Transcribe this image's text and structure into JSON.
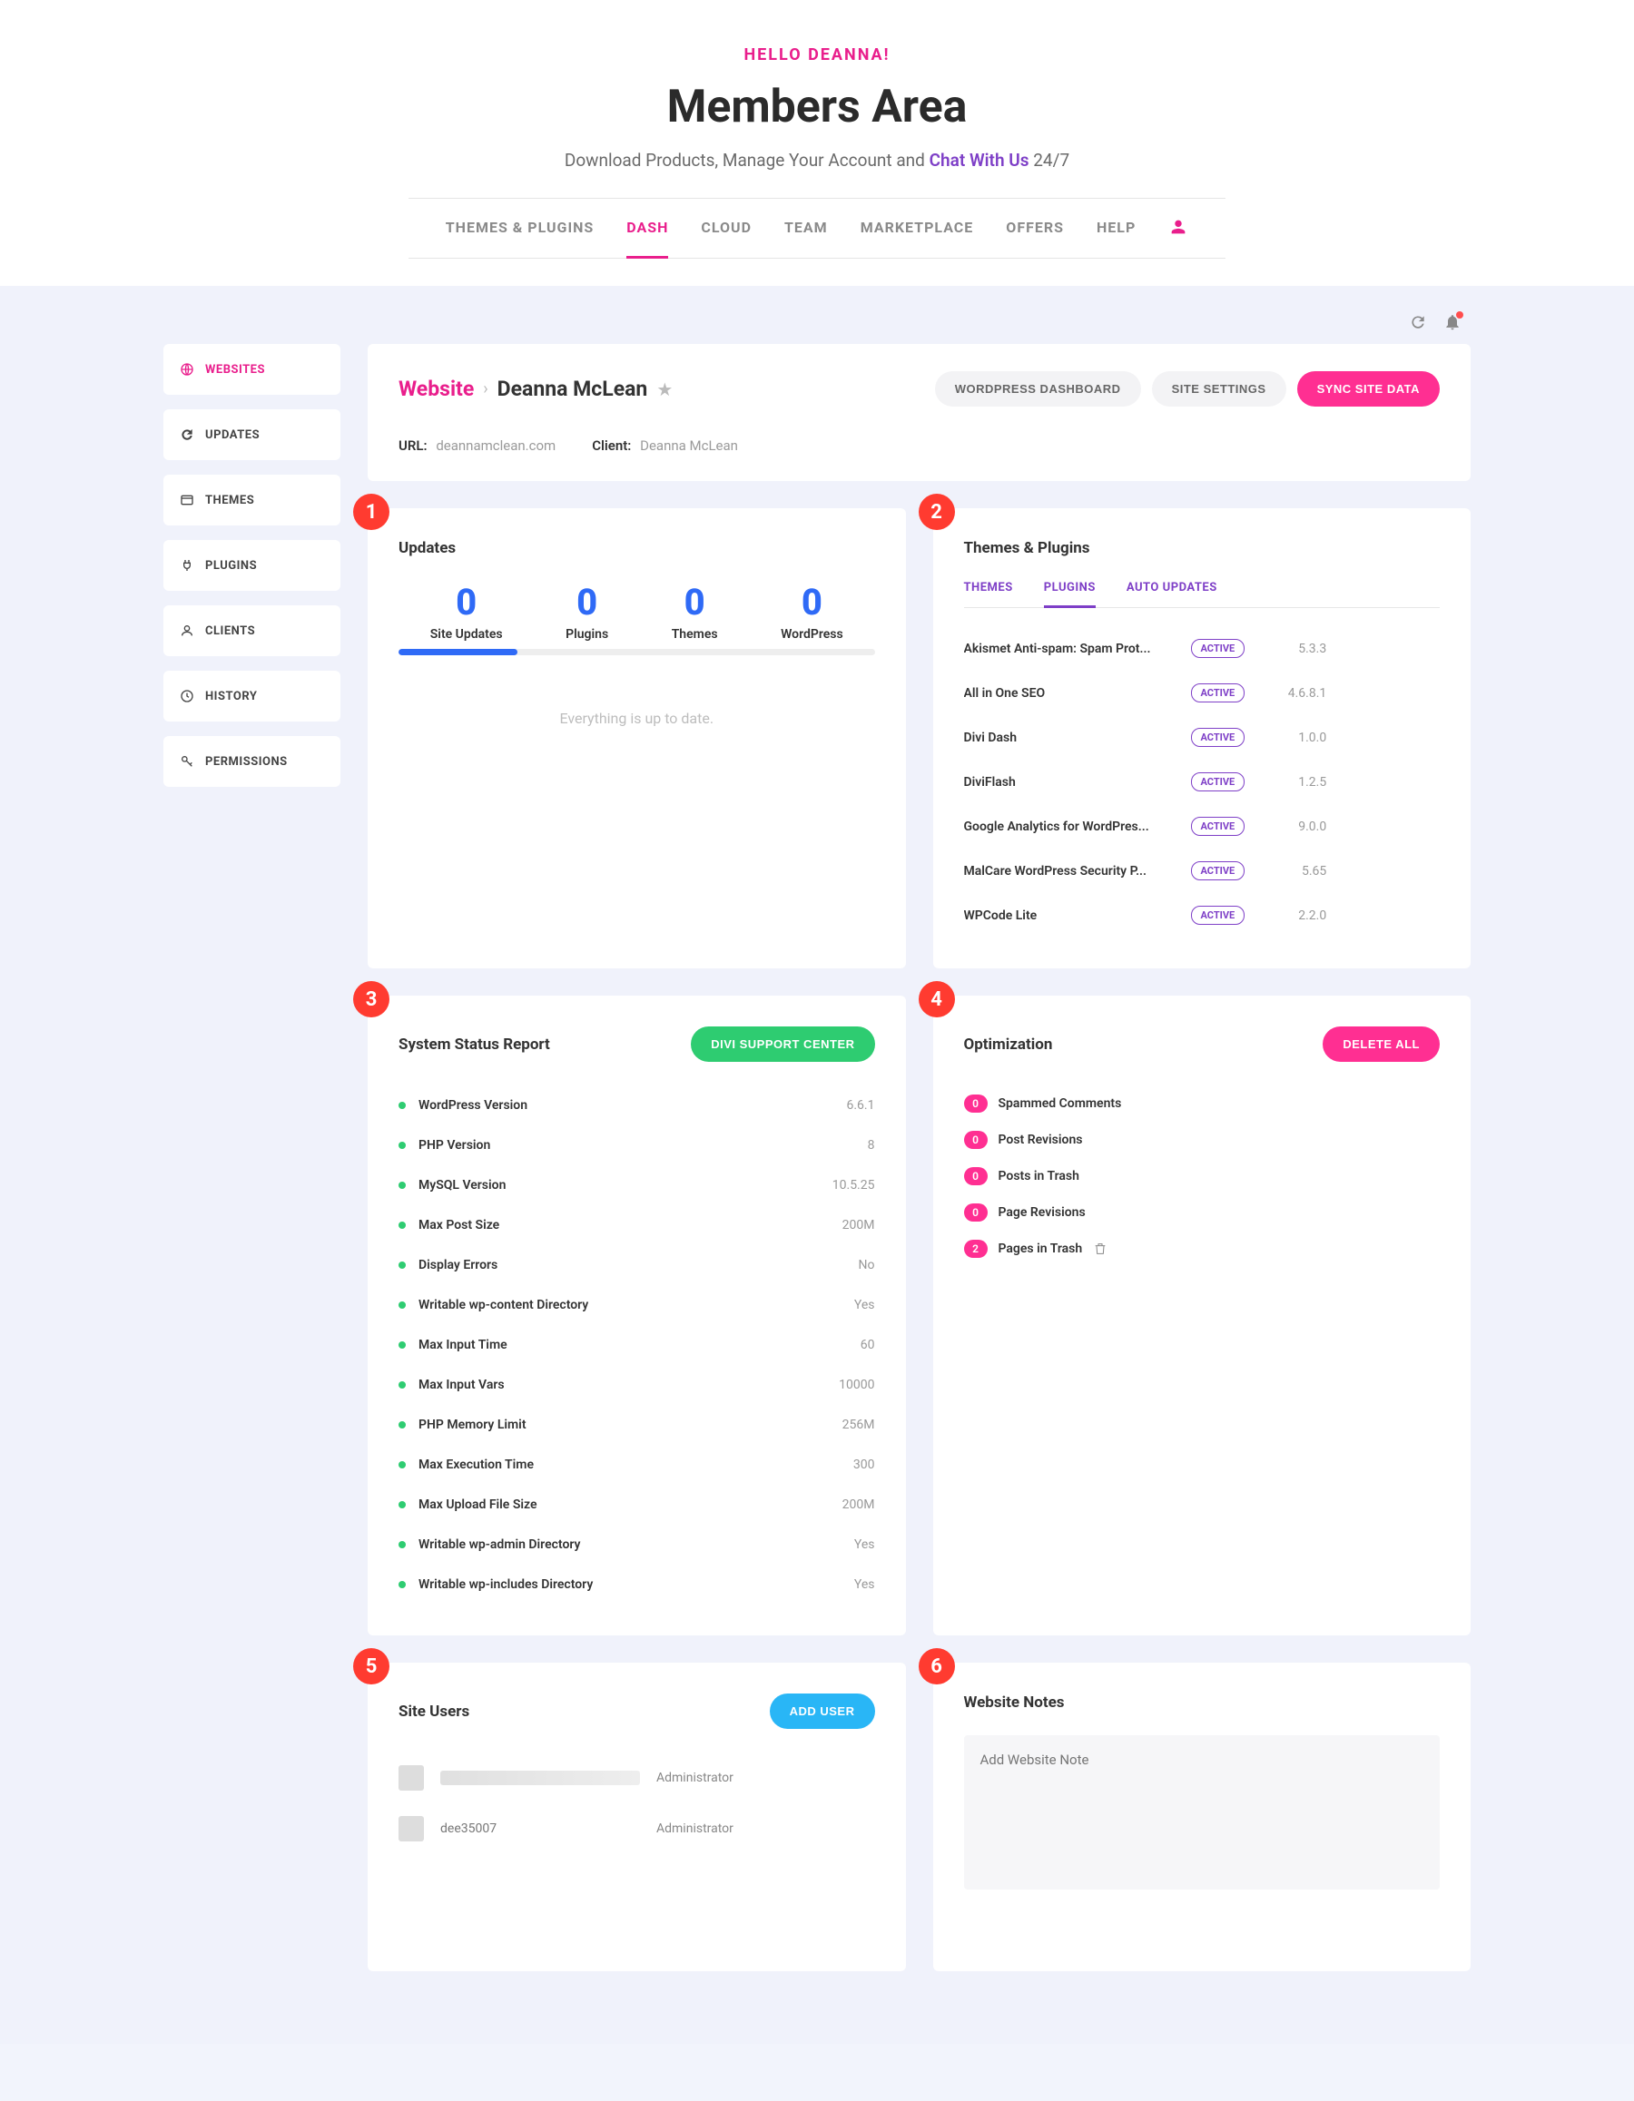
{
  "hero": {
    "greeting": "HELLO DEANNA!",
    "title": "Members Area",
    "subtitle_pre": "Download Products, Manage Your Account and ",
    "subtitle_link": "Chat With Us",
    "subtitle_post": " 24/7"
  },
  "topnav": {
    "items": [
      {
        "label": "THEMES & PLUGINS",
        "active": false
      },
      {
        "label": "DASH",
        "active": true
      },
      {
        "label": "CLOUD",
        "active": false
      },
      {
        "label": "TEAM",
        "active": false
      },
      {
        "label": "MARKETPLACE",
        "active": false
      },
      {
        "label": "OFFERS",
        "active": false
      },
      {
        "label": "HELP",
        "active": false
      }
    ]
  },
  "sidebar": {
    "items": [
      {
        "label": "WEBSITES",
        "icon": "globe",
        "active": true
      },
      {
        "label": "UPDATES",
        "icon": "refresh",
        "active": false
      },
      {
        "label": "THEMES",
        "icon": "card",
        "active": false
      },
      {
        "label": "PLUGINS",
        "icon": "plug",
        "active": false
      },
      {
        "label": "CLIENTS",
        "icon": "user",
        "active": false
      },
      {
        "label": "HISTORY",
        "icon": "clock",
        "active": false
      },
      {
        "label": "PERMISSIONS",
        "icon": "key",
        "active": false
      }
    ]
  },
  "site_header": {
    "breadcrumb_root": "Website",
    "breadcrumb_name": "Deanna McLean",
    "buttons": {
      "wp_dashboard": "WORDPRESS DASHBOARD",
      "site_settings": "SITE SETTINGS",
      "sync": "SYNC SITE DATA"
    },
    "url_label": "URL:",
    "url_value": "deannamclean.com",
    "client_label": "Client:",
    "client_value": "Deanna McLean"
  },
  "annotations": [
    "1",
    "2",
    "3",
    "4",
    "5",
    "6"
  ],
  "updates": {
    "title": "Updates",
    "stats": [
      {
        "num": "0",
        "label": "Site Updates"
      },
      {
        "num": "0",
        "label": "Plugins"
      },
      {
        "num": "0",
        "label": "Themes"
      },
      {
        "num": "0",
        "label": "WordPress"
      }
    ],
    "empty": "Everything is up to date."
  },
  "themes_plugins": {
    "title": "Themes & Plugins",
    "tabs": [
      {
        "label": "THEMES",
        "active": false
      },
      {
        "label": "PLUGINS",
        "active": true
      },
      {
        "label": "AUTO UPDATES",
        "active": false
      }
    ],
    "status_label": "ACTIVE",
    "rows": [
      {
        "name": "Akismet Anti-spam: Spam Prot...",
        "version": "5.3.3"
      },
      {
        "name": "All in One SEO",
        "version": "4.6.8.1"
      },
      {
        "name": "Divi Dash",
        "version": "1.0.0"
      },
      {
        "name": "DiviFlash",
        "version": "1.2.5"
      },
      {
        "name": "Google Analytics for WordPres...",
        "version": "9.0.0"
      },
      {
        "name": "MalCare WordPress Security P...",
        "version": "5.65"
      },
      {
        "name": "WPCode Lite",
        "version": "2.2.0"
      }
    ]
  },
  "system_status": {
    "title": "System Status Report",
    "button": "DIVI SUPPORT CENTER",
    "rows": [
      {
        "name": "WordPress Version",
        "value": "6.6.1"
      },
      {
        "name": "PHP Version",
        "value": "8"
      },
      {
        "name": "MySQL Version",
        "value": "10.5.25"
      },
      {
        "name": "Max Post Size",
        "value": "200M"
      },
      {
        "name": "Display Errors",
        "value": "No"
      },
      {
        "name": "Writable wp-content Directory",
        "value": "Yes"
      },
      {
        "name": "Max Input Time",
        "value": "60"
      },
      {
        "name": "Max Input Vars",
        "value": "10000"
      },
      {
        "name": "PHP Memory Limit",
        "value": "256M"
      },
      {
        "name": "Max Execution Time",
        "value": "300"
      },
      {
        "name": "Max Upload File Size",
        "value": "200M"
      },
      {
        "name": "Writable wp-admin Directory",
        "value": "Yes"
      },
      {
        "name": "Writable wp-includes Directory",
        "value": "Yes"
      }
    ]
  },
  "optimization": {
    "title": "Optimization",
    "button": "DELETE ALL",
    "rows": [
      {
        "count": "0",
        "label": "Spammed Comments",
        "trash": false
      },
      {
        "count": "0",
        "label": "Post Revisions",
        "trash": false
      },
      {
        "count": "0",
        "label": "Posts in Trash",
        "trash": false
      },
      {
        "count": "0",
        "label": "Page Revisions",
        "trash": false
      },
      {
        "count": "2",
        "label": "Pages in Trash",
        "trash": true
      }
    ]
  },
  "site_users": {
    "title": "Site Users",
    "button": "ADD USER",
    "rows": [
      {
        "name": "",
        "role": "Administrator",
        "blurred": true
      },
      {
        "name": "dee35007",
        "role": "Administrator",
        "blurred": false
      }
    ]
  },
  "notes": {
    "title": "Website Notes",
    "placeholder": "Add Website Note"
  }
}
